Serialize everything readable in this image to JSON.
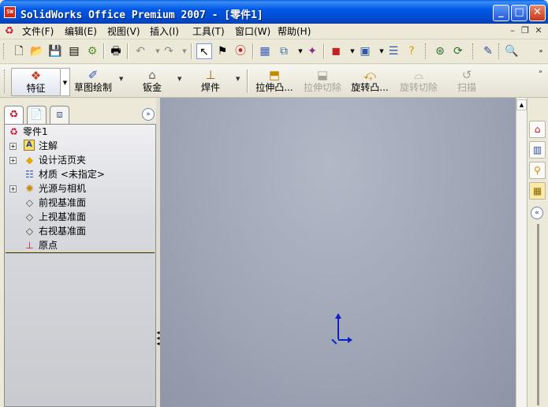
{
  "window": {
    "app_icon_label": "SW",
    "title": "SolidWorks Office Premium 2007 - [零件1]",
    "minimize_glyph": "_",
    "maximize_glyph": "□",
    "close_glyph": "✕"
  },
  "menubar": {
    "items": [
      "文件(F)",
      "编辑(E)",
      "视图(V)",
      "插入(I)",
      "工具(T)",
      "窗口(W)",
      "帮助(H)"
    ],
    "doc_controls": [
      "–",
      "❐",
      "✕"
    ]
  },
  "toolbar": {
    "icons": [
      "new-document",
      "open-folder",
      "save",
      "print-preview",
      "options",
      "print",
      "undo",
      "redo",
      "select-arrow",
      "select-filter",
      "rebuild-traffic-light",
      "grid",
      "view-orientation",
      "display-style",
      "appearance",
      "view-section",
      "help",
      "zoom"
    ]
  },
  "command_manager": {
    "items": [
      {
        "label": "特征",
        "enabled": true
      },
      {
        "label": "草图绘制",
        "enabled": true
      },
      {
        "label": "钣金",
        "enabled": true
      },
      {
        "label": "焊件",
        "enabled": true
      },
      {
        "label": "拉伸凸...",
        "enabled": true
      },
      {
        "label": "拉伸切除",
        "enabled": false
      },
      {
        "label": "旋转凸...",
        "enabled": true
      },
      {
        "label": "旋转切除",
        "enabled": false
      },
      {
        "label": "扫描",
        "enabled": false
      }
    ]
  },
  "panel": {
    "expand_glyph": "»"
  },
  "feature_tree": {
    "root": "零件1",
    "nodes": [
      {
        "label": "注解",
        "expandable": true,
        "icon": "annotations-icon"
      },
      {
        "label": "设计活页夹",
        "expandable": true,
        "icon": "design-binder-icon"
      },
      {
        "label": "材质 <未指定>",
        "expandable": false,
        "icon": "material-icon"
      },
      {
        "label": "光源与相机",
        "expandable": true,
        "icon": "lights-cameras-icon"
      },
      {
        "label": "前视基准面",
        "expandable": false,
        "icon": "plane-icon"
      },
      {
        "label": "上视基准面",
        "expandable": false,
        "icon": "plane-icon"
      },
      {
        "label": "右视基准面",
        "expandable": false,
        "icon": "plane-icon"
      },
      {
        "label": "原点",
        "expandable": false,
        "icon": "origin-icon"
      }
    ]
  },
  "taskpane": {
    "collapse_glyph": "«"
  },
  "colors": {
    "title_bar": "#0058e6",
    "viewport": "#9da4b4",
    "origin_axes": "#1020c8",
    "tree_rollback": "#282828"
  }
}
